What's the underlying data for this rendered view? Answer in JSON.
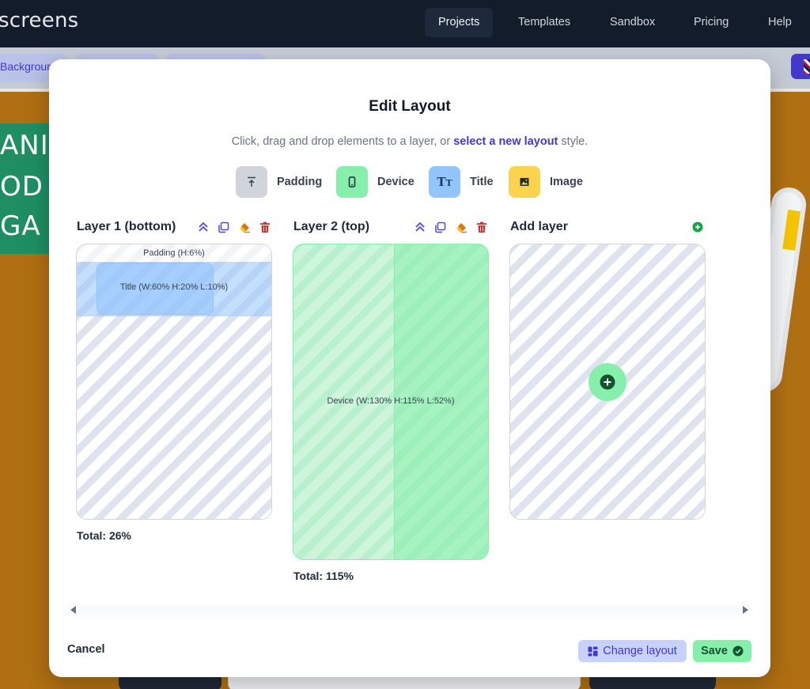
{
  "nav": {
    "brand": "screens",
    "items": [
      {
        "label": "Projects",
        "active": true
      },
      {
        "label": "Templates"
      },
      {
        "label": "Sandbox"
      },
      {
        "label": "Pricing"
      },
      {
        "label": "Help"
      }
    ]
  },
  "toolbar": {
    "first_pill": "Backgrour"
  },
  "canvas": {
    "text_lines": [
      "ANI",
      "OD",
      "GA"
    ]
  },
  "modal": {
    "title": "Edit Layout",
    "subtitle_before": "Click, drag and drop elements to a layer, or ",
    "subtitle_link": "select a new layout",
    "subtitle_after": " style.",
    "elements": [
      {
        "label": "Padding",
        "color": "#d1d5db"
      },
      {
        "label": "Device",
        "color": "#86efac"
      },
      {
        "label": "Title",
        "color": "#93c5fd"
      },
      {
        "label": "Image",
        "color": "#fcd34d"
      }
    ],
    "layers": [
      {
        "title": "Layer 1 (bottom)",
        "padding_label": "Padding (H:6%)",
        "title_label": "Title (W:60% H:20% L:10%)",
        "total": "Total: 26%"
      },
      {
        "title": "Layer 2 (top)",
        "device_label": "Device (W:130% H:115% L:52%)",
        "total": "Total: 115%"
      }
    ],
    "add_layer": "Add layer",
    "cancel": "Cancel",
    "change_layout": "Change layout",
    "save": "Save"
  },
  "colors": {
    "accent": "#4338ca",
    "nav_bg": "#131c2b",
    "canvas_bg": "#b06f12",
    "success": "#86efac",
    "danger": "#dc2626",
    "warning": "#d97706"
  }
}
